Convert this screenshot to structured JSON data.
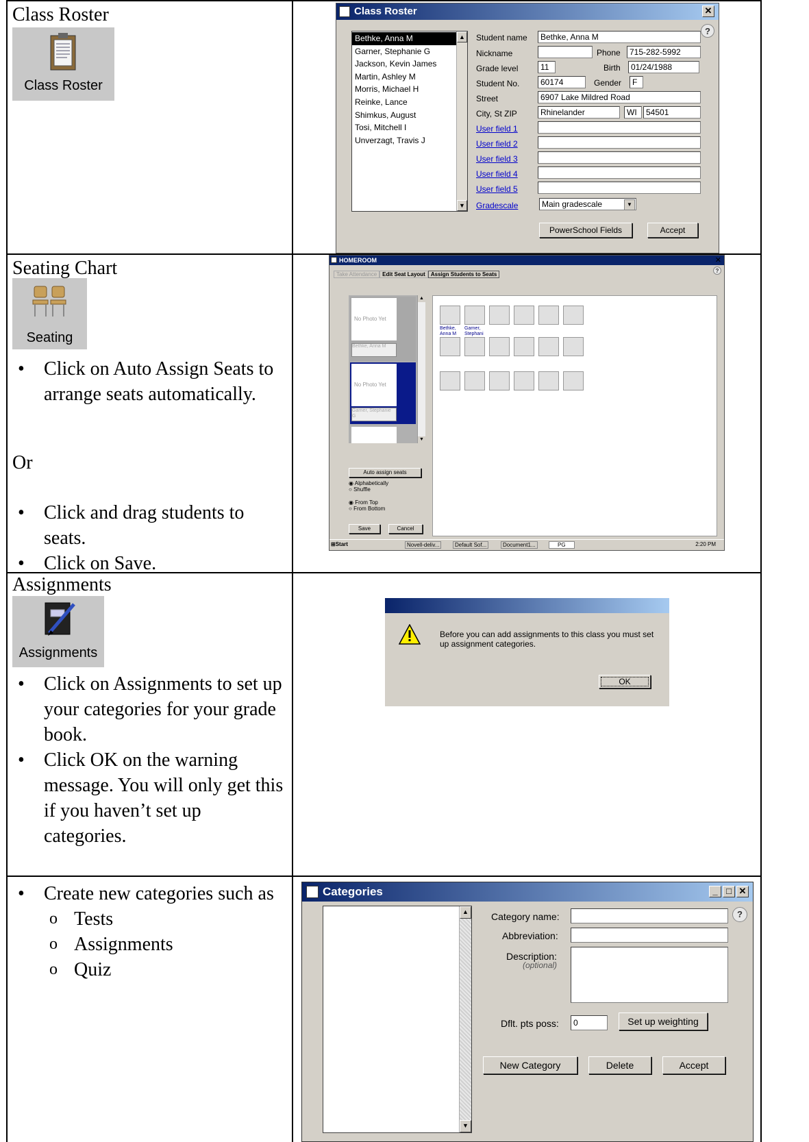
{
  "rows": {
    "roster": {
      "title": "Class Roster",
      "icon_label": "Class Roster",
      "icon": "clipboard-icon"
    },
    "seating": {
      "title": "Seating Chart",
      "icon_label": "Seating",
      "icon": "chairs-icon",
      "bullets_a": [
        "Click on Auto Assign Seats to arrange seats automatically."
      ],
      "or_text": "Or",
      "bullets_b": [
        "Click and drag students to seats.",
        "Click on Save."
      ]
    },
    "assignments": {
      "title": "Assignments",
      "icon_label": "Assignments",
      "icon": "notebook-icon",
      "bullets": [
        "Click on Assignments to set up your categories for your grade book.",
        "Click OK on the warning message.  You will only get this if you haven’t set up categories."
      ]
    },
    "categories": {
      "bullet": "Create new categories such as",
      "sub_items": [
        "Tests",
        "Assignments",
        "Quiz"
      ]
    }
  },
  "roster_window": {
    "title": "Class Roster",
    "students": [
      "Bethke, Anna M",
      "Garner, Stephanie G",
      "Jackson, Kevin James",
      "Martin, Ashley M",
      "Morris, Michael H",
      "Reinke, Lance",
      "Shimkus, August",
      "Tosi, Mitchell I",
      "Unverzagt, Travis J"
    ],
    "labels": {
      "student_name": "Student name",
      "nickname": "Nickname",
      "phone": "Phone",
      "grade_level": "Grade level",
      "birth": "Birth",
      "student_no": "Student No.",
      "gender": "Gender",
      "street": "Street",
      "city": "City, St ZIP",
      "user1": "User field 1",
      "user2": "User field 2",
      "user3": "User field 3",
      "user4": "User field 4",
      "user5": "User field 5",
      "gradescale": "Gradescale"
    },
    "values": {
      "student_name": "Bethke, Anna M",
      "nickname": "",
      "phone": "715-282-5992",
      "grade_level": "11",
      "birth": "01/24/1988",
      "student_no": "60174",
      "gender": "F",
      "street": "6907 Lake Mildred Road",
      "city": "Rhinelander",
      "state": "WI",
      "zip": "54501",
      "gradescale": "Main gradescale"
    },
    "buttons": {
      "powerschool": "PowerSchool Fields",
      "accept": "Accept"
    }
  },
  "seating_window": {
    "title": "HOMEROOM",
    "tabs": [
      "Take Attendance",
      "Edit Seat Layout",
      "Assign Students to Seats"
    ],
    "photo_text": "No Photo Yet",
    "photo_names": [
      "Bethke, Anna M",
      "Garner, Stephanie G"
    ],
    "seat_names": [
      "Bethke, Anna M",
      "Garner, Stephani"
    ],
    "auto_assign": "Auto assign seats",
    "options_a": [
      "Alphabetically",
      "Shuffle"
    ],
    "options_b": [
      "From Top",
      "From Bottom"
    ],
    "save": "Save",
    "cancel": "Cancel",
    "taskbar": {
      "start": "Start",
      "items": [
        "Novell-deliv...",
        "Default Sof...",
        "Document1...",
        "PG"
      ],
      "time": "2:20 PM"
    }
  },
  "warning_dialog": {
    "message": "Before you can add assignments to this class you must set up assignment categories.",
    "ok": "OK"
  },
  "categories_window": {
    "title": "Categories",
    "labels": {
      "category_name": "Category name:",
      "abbreviation": "Abbreviation:",
      "description": "Description:",
      "optional": "(optional)",
      "dflt_pts": "Dflt. pts poss:"
    },
    "values": {
      "dflt_pts": "0"
    },
    "buttons": {
      "weighting": "Set up weighting",
      "new_category": "New Category",
      "delete": "Delete",
      "accept": "Accept"
    }
  }
}
